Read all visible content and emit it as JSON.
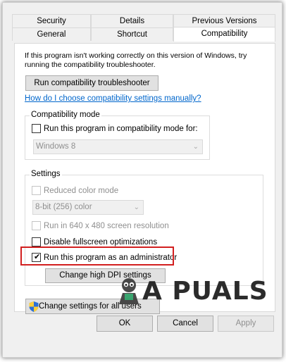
{
  "tabs": {
    "row1": [
      "Security",
      "Details",
      "Previous Versions"
    ],
    "row2": [
      "General",
      "Shortcut",
      "Compatibility"
    ]
  },
  "intro_text": "If this program isn't working correctly on this version of Windows, try running the compatibility troubleshooter.",
  "troubleshooter_button": "Run compatibility troubleshooter",
  "help_link": "How do I choose compatibility settings manually?",
  "compat_mode": {
    "title": "Compatibility mode",
    "checkbox_label": "Run this program in compatibility mode for:",
    "checked": false,
    "os_selected": "Windows 8"
  },
  "settings": {
    "title": "Settings",
    "reduced_color": {
      "label": "Reduced color mode",
      "checked": false
    },
    "color_selected": "8-bit (256) color",
    "res_640": {
      "label": "Run in 640 x 480 screen resolution",
      "checked": false
    },
    "disable_fullscreen": {
      "label": "Disable fullscreen optimizations",
      "checked": false
    },
    "run_admin": {
      "label": "Run this program as an administrator",
      "checked": true
    },
    "dpi_button": "Change high DPI settings"
  },
  "all_users_button": "Change settings for all users",
  "footer": {
    "ok": "OK",
    "cancel": "Cancel",
    "apply": "Apply"
  },
  "watermark": "A PUALS",
  "colors": {
    "link": "#0066cc",
    "highlight": "#d21f1f"
  }
}
